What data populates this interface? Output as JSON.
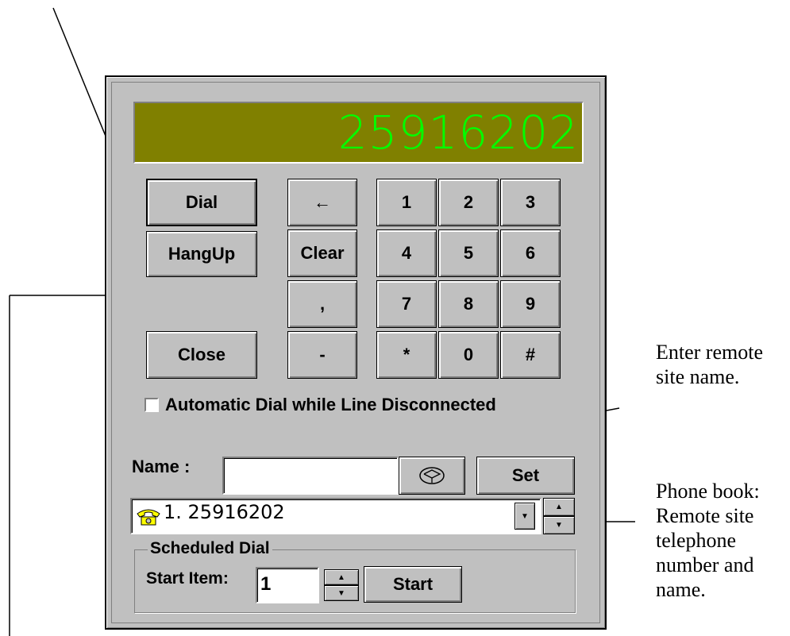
{
  "display": {
    "number": "25916202"
  },
  "buttons": {
    "dial": "Dial",
    "hangup": "HangUp",
    "close": "Close",
    "backspace": "←",
    "clear": "Clear",
    "comma": ",",
    "dash": "-",
    "keypad": [
      "1",
      "2",
      "3",
      "4",
      "5",
      "6",
      "7",
      "8",
      "9",
      "*",
      "0",
      "#"
    ],
    "set": "Set",
    "start": "Start"
  },
  "auto_dial": {
    "label": "Automatic Dial while Line Disconnected",
    "checked": false
  },
  "name_field": {
    "label": "Name :",
    "value": ""
  },
  "phonebook": {
    "selected": "1. 25916202",
    "icon": "phone-icon"
  },
  "scheduled": {
    "title": "Scheduled Dial",
    "start_item_label": "Start Item:",
    "start_item_value": "1"
  },
  "annotations": {
    "enter_name": "Enter remote site name.",
    "phone_book": "Phone book: Remote site telephone number and name."
  },
  "colors": {
    "display_bg": "#808000",
    "display_text": "#00ff00",
    "panel": "#c0c0c0"
  }
}
